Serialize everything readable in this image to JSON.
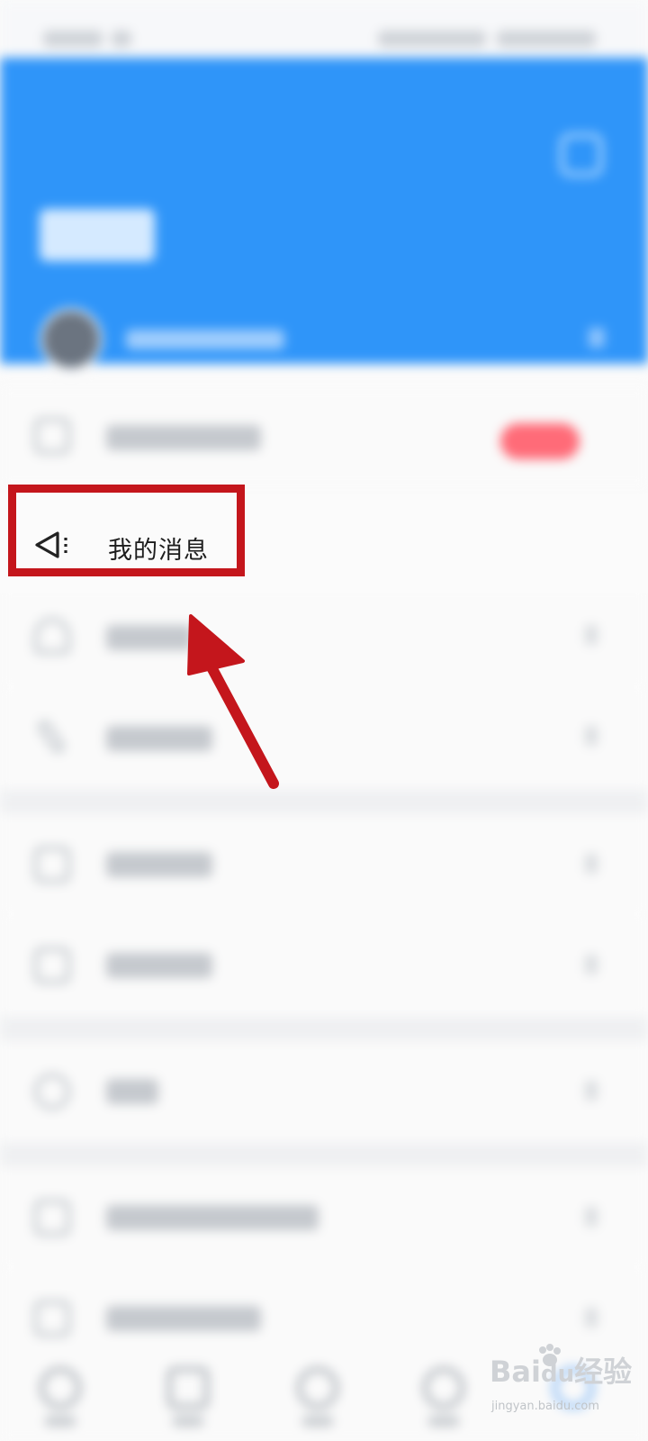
{
  "menu": {
    "highlighted_item": {
      "label": "我的消息",
      "icon": "megaphone-icon"
    }
  },
  "annotation": {
    "box_color": "#c4161c",
    "arrow_color": "#c4161c"
  },
  "colors": {
    "header": "#2f95f9",
    "badge": "#ff6b78"
  },
  "watermark": {
    "brand": "Bai",
    "brand_suffix": "经验",
    "url": "jingyan.baidu.com"
  }
}
